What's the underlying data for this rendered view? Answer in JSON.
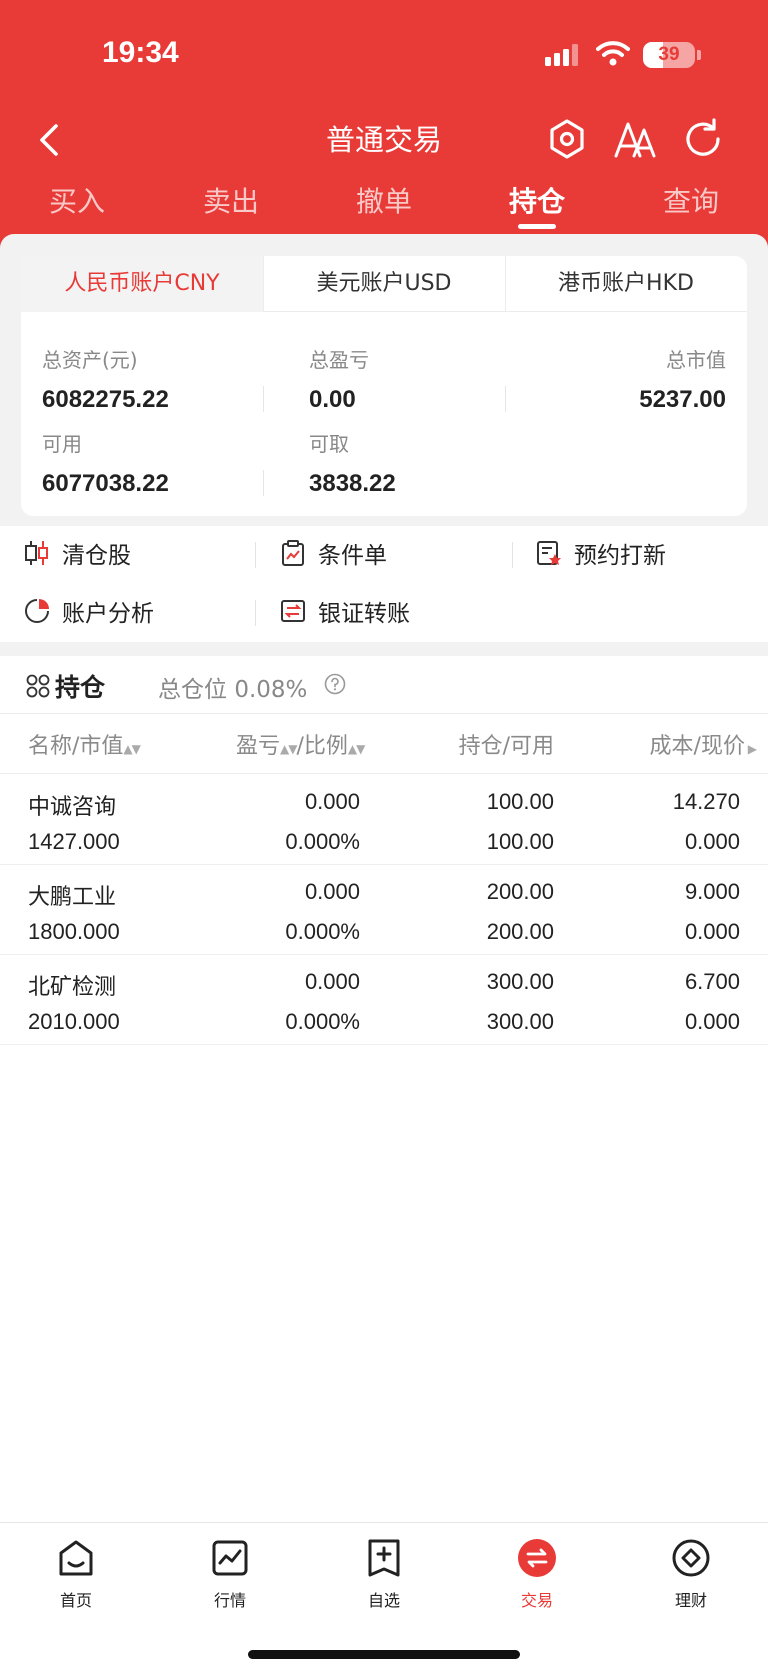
{
  "status_bar": {
    "time": "19:34",
    "battery": "39",
    "battery_level": 0.39
  },
  "nav": {
    "title": "普通交易",
    "back_icon": "chevron-left-icon",
    "icons": [
      "settings-hexagon-icon",
      "font-size-icon",
      "refresh-icon"
    ]
  },
  "tabs": [
    {
      "label": "买入",
      "active": false
    },
    {
      "label": "卖出",
      "active": false
    },
    {
      "label": "撤单",
      "active": false
    },
    {
      "label": "持仓",
      "active": true
    },
    {
      "label": "查询",
      "active": false
    }
  ],
  "account_tabs": [
    {
      "label": "人民币账户CNY",
      "active": true
    },
    {
      "label": "美元账户USD",
      "active": false
    },
    {
      "label": "港币账户HKD",
      "active": false
    }
  ],
  "account_stats": {
    "total_assets_label": "总资产(元)",
    "total_assets": "6082275.22",
    "total_pnl_label": "总盈亏",
    "total_pnl": "0.00",
    "market_value_label": "总市值",
    "market_value": "5237.00",
    "available_label": "可用",
    "available": "6077038.22",
    "withdrawable_label": "可取",
    "withdrawable": "3838.22"
  },
  "quick_actions": [
    {
      "label": "清仓股",
      "icon": "candlestick-icon"
    },
    {
      "label": "条件单",
      "icon": "clipboard-chart-icon"
    },
    {
      "label": "预约打新",
      "icon": "reservation-doc-icon"
    },
    {
      "label": "账户分析",
      "icon": "pie-chart-icon"
    },
    {
      "label": "银证转账",
      "icon": "bank-transfer-icon"
    }
  ],
  "holdings": {
    "title": "持仓",
    "title_icon": "grid-icon",
    "total_position_label": "总仓位",
    "total_position_value": "0.08%",
    "help_icon": "question-circle-icon",
    "columns": [
      "名称/市值",
      "盈亏",
      "/比例",
      "持仓/可用",
      "成本/现价"
    ],
    "rows": [
      {
        "name": "中诚咨询",
        "market_value": "1427.000",
        "pnl": "0.000",
        "ratio": "0.000%",
        "position": "100.00",
        "available": "100.00",
        "cost": "14.270",
        "price": "0.000"
      },
      {
        "name": "大鹏工业",
        "market_value": "1800.000",
        "pnl": "0.000",
        "ratio": "0.000%",
        "position": "200.00",
        "available": "200.00",
        "cost": "9.000",
        "price": "0.000"
      },
      {
        "name": "北矿检测",
        "market_value": "2010.000",
        "pnl": "0.000",
        "ratio": "0.000%",
        "position": "300.00",
        "available": "300.00",
        "cost": "6.700",
        "price": "0.000"
      }
    ]
  },
  "bottom_nav": [
    {
      "label": "首页",
      "icon": "home-icon",
      "active": false
    },
    {
      "label": "行情",
      "icon": "market-chart-icon",
      "active": false
    },
    {
      "label": "自选",
      "icon": "watchlist-add-icon",
      "active": false
    },
    {
      "label": "交易",
      "icon": "trade-exchange-icon",
      "active": true
    },
    {
      "label": "理财",
      "icon": "finance-icon",
      "active": false
    }
  ],
  "colors": {
    "brand_red": "#e83a37",
    "page_bg": "#f2f2f2"
  }
}
